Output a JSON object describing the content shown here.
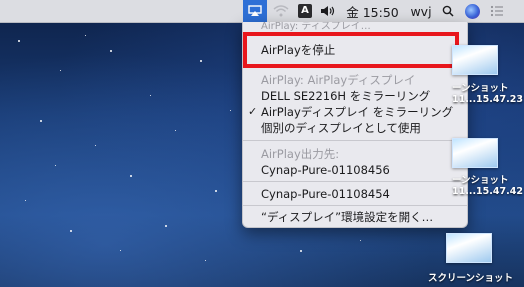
{
  "menubar": {
    "clock": "金 15:50",
    "user": "wvj",
    "input_source": "A",
    "icons": [
      "airplay-icon",
      "wifi-icon",
      "input-source-icon",
      "volume-icon",
      "search-icon",
      "siri-icon",
      "notification-center-icon"
    ]
  },
  "airplay_menu": {
    "header_partial": "AirPlay: ディスプレイ…",
    "stop": "AirPlayを停止",
    "section_display": "AirPlay: AirPlayディスプレイ",
    "mirror_dell": "DELL SE2216H をミラーリング",
    "mirror_airplay": "AirPlayディスプレイ をミラーリング",
    "mirror_checkmark": "✓",
    "separate_display": "個別のディスプレイとして使用",
    "section_output": "AirPlay出力先:",
    "device_1": "Cynap-Pure-01108456",
    "device_2": "Cynap-Pure-01108454",
    "open_prefs": "“ディスプレイ”環境設定を開く…"
  },
  "desktop_items": [
    {
      "label_line1": "ーンショット",
      "label_line2": "11...15.47.23"
    },
    {
      "label_line1": "ーンショット",
      "label_line2": "11...15.47.42"
    },
    {
      "label_line1": "スクリーンショット",
      "label_line2": ""
    }
  ],
  "colors": {
    "highlight_border": "#e8161c",
    "airplay_active_bg": "#2d6fd6",
    "menu_bg": "#e9e9ee"
  }
}
